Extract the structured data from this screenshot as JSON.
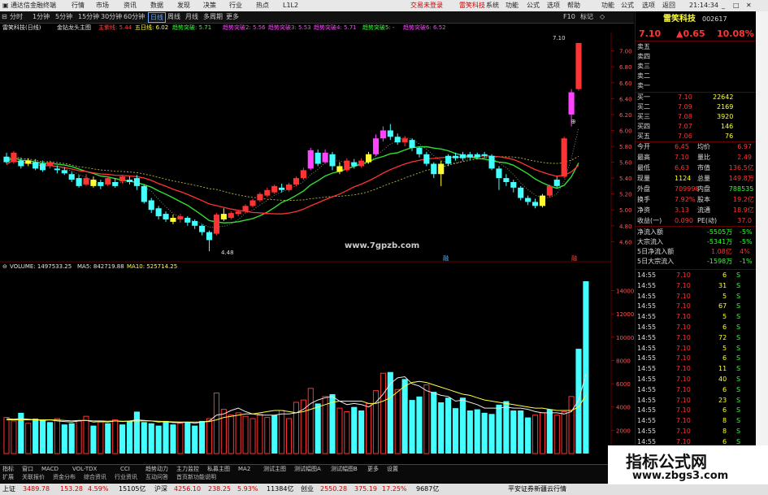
{
  "titlebar": {
    "app_name": "通达信金融终端",
    "menus": [
      "行情",
      "市场",
      "资讯",
      "数据",
      "发现",
      "决策",
      "行业",
      "热点",
      "L1L2"
    ],
    "center_links": [
      "交易未登录",
      "雷笑科技"
    ],
    "right_menus": [
      "系统",
      "功能",
      "公式",
      "选项",
      "帮助"
    ],
    "right_links": [
      "功能",
      "公式",
      "选项",
      "返回"
    ],
    "time": "21:14:34",
    "quote_label": "行情"
  },
  "periodbar": {
    "periods": [
      "分时",
      "1分钟",
      "5分钟",
      "15分钟",
      "30分钟",
      "60分钟",
      "日线",
      "周线",
      "月线",
      "多周期",
      "更多"
    ],
    "selected": "日线",
    "tools": [
      "F10",
      "标记",
      "◇"
    ]
  },
  "chart_info": {
    "stock_label": "雷笑科技(日线)",
    "indicator": "金钻龙头主图",
    "items": [
      {
        "text": "主紫线: 5.44",
        "color": "#ff4444"
      },
      {
        "text": "五日线: 6.02",
        "color": "#ffff44"
      },
      {
        "text": "趋势突破: 5.71",
        "color": "#33ff33"
      },
      {
        "text": "趋势突破2: 5.56",
        "color": "#ff44ff"
      },
      {
        "text": "趋势突破3: 5.53",
        "color": "#ff44ff"
      },
      {
        "text": "趋势突破4: 5.71",
        "color": "#ff44ff"
      },
      {
        "text": "趋势突破5: -",
        "color": "#33ff33"
      },
      {
        "text": "趋势突破6: 6.52",
        "color": "#ff44ff"
      }
    ],
    "high_label": "7.10",
    "low_label": "4.48",
    "watermark_site": "www.7gpzb.com",
    "axis_ticks": [
      "7.00",
      "6.80",
      "6.60",
      "6.40",
      "6.20",
      "6.00",
      "5.80",
      "5.60",
      "5.40",
      "5.20",
      "5.00",
      "4.80",
      "4.60"
    ],
    "markers": [
      "⊕",
      "融"
    ]
  },
  "chart_data": {
    "type": "candlestick",
    "title": "雷笑科技(日线)",
    "ylim": [
      4.45,
      7.15
    ],
    "candles": [
      {
        "o": 5.67,
        "c": 5.6,
        "h": 5.72,
        "l": 5.58,
        "col": "c"
      },
      {
        "o": 5.6,
        "c": 5.72,
        "h": 5.74,
        "l": 5.58,
        "col": "r"
      },
      {
        "o": 5.62,
        "c": 5.55,
        "h": 5.66,
        "l": 5.52,
        "col": "c"
      },
      {
        "o": 5.58,
        "c": 5.62,
        "h": 5.65,
        "l": 5.55,
        "col": "y"
      },
      {
        "o": 5.6,
        "c": 5.52,
        "h": 5.64,
        "l": 5.5,
        "col": "c"
      },
      {
        "o": 5.58,
        "c": 5.5,
        "h": 5.62,
        "l": 5.48,
        "col": "c"
      },
      {
        "o": 5.55,
        "c": 5.6,
        "h": 5.62,
        "l": 5.52,
        "col": "r"
      },
      {
        "o": 5.52,
        "c": 5.5,
        "h": 5.56,
        "l": 5.46,
        "col": "c"
      },
      {
        "o": 5.5,
        "c": 5.46,
        "h": 5.54,
        "l": 5.44,
        "col": "c"
      },
      {
        "o": 5.45,
        "c": 5.38,
        "h": 5.48,
        "l": 5.35,
        "col": "c"
      },
      {
        "o": 5.4,
        "c": 5.3,
        "h": 5.44,
        "l": 5.28,
        "col": "c"
      },
      {
        "o": 5.32,
        "c": 5.4,
        "h": 5.45,
        "l": 5.3,
        "col": "r"
      },
      {
        "o": 5.38,
        "c": 5.3,
        "h": 5.42,
        "l": 5.28,
        "col": "y"
      },
      {
        "o": 5.35,
        "c": 5.3,
        "h": 5.38,
        "l": 5.26,
        "col": "c"
      },
      {
        "o": 5.32,
        "c": 5.4,
        "h": 5.42,
        "l": 5.3,
        "col": "r"
      },
      {
        "o": 5.35,
        "c": 5.3,
        "h": 5.4,
        "l": 5.28,
        "col": "c"
      },
      {
        "o": 5.36,
        "c": 5.42,
        "h": 5.44,
        "l": 5.33,
        "col": "r"
      },
      {
        "o": 5.38,
        "c": 5.35,
        "h": 5.42,
        "l": 5.32,
        "col": "c"
      },
      {
        "o": 5.4,
        "c": 5.3,
        "h": 5.44,
        "l": 5.25,
        "col": "c"
      },
      {
        "o": 5.3,
        "c": 5.1,
        "h": 5.32,
        "l": 5.08,
        "col": "c"
      },
      {
        "o": 5.12,
        "c": 5.0,
        "h": 5.15,
        "l": 4.96,
        "col": "c"
      },
      {
        "o": 5.02,
        "c": 4.92,
        "h": 5.05,
        "l": 4.88,
        "col": "c"
      },
      {
        "o": 4.95,
        "c": 4.88,
        "h": 4.98,
        "l": 4.85,
        "col": "c"
      },
      {
        "o": 4.9,
        "c": 4.85,
        "h": 4.94,
        "l": 4.82,
        "col": "y"
      },
      {
        "o": 4.88,
        "c": 4.92,
        "h": 4.95,
        "l": 4.84,
        "col": "r"
      },
      {
        "o": 4.9,
        "c": 4.84,
        "h": 4.92,
        "l": 4.8,
        "col": "c"
      },
      {
        "o": 4.86,
        "c": 4.8,
        "h": 4.88,
        "l": 4.76,
        "col": "c"
      },
      {
        "o": 4.8,
        "c": 4.72,
        "h": 4.82,
        "l": 4.68,
        "col": "c"
      },
      {
        "o": 4.72,
        "c": 4.62,
        "h": 4.74,
        "l": 4.48,
        "col": "c"
      },
      {
        "o": 4.7,
        "c": 4.94,
        "h": 4.96,
        "l": 4.68,
        "col": "r"
      },
      {
        "o": 4.95,
        "c": 4.88,
        "h": 5.02,
        "l": 4.86,
        "col": "y"
      },
      {
        "o": 4.9,
        "c": 4.96,
        "h": 4.98,
        "l": 4.88,
        "col": "r"
      },
      {
        "o": 4.95,
        "c": 4.98,
        "h": 5.0,
        "l": 4.92,
        "col": "r"
      },
      {
        "o": 4.98,
        "c": 5.05,
        "h": 5.07,
        "l": 4.96,
        "col": "r"
      },
      {
        "o": 5.05,
        "c": 5.12,
        "h": 5.14,
        "l": 5.03,
        "col": "r"
      },
      {
        "o": 5.12,
        "c": 5.2,
        "h": 5.22,
        "l": 5.1,
        "col": "r"
      },
      {
        "o": 5.18,
        "c": 5.25,
        "h": 5.28,
        "l": 5.16,
        "col": "r"
      },
      {
        "o": 5.22,
        "c": 5.3,
        "h": 5.32,
        "l": 5.2,
        "col": "r"
      },
      {
        "o": 5.28,
        "c": 5.25,
        "h": 5.33,
        "l": 5.22,
        "col": "c"
      },
      {
        "o": 5.25,
        "c": 5.32,
        "h": 5.34,
        "l": 5.23,
        "col": "r"
      },
      {
        "o": 5.32,
        "c": 5.4,
        "h": 5.42,
        "l": 5.3,
        "col": "r"
      },
      {
        "o": 5.4,
        "c": 5.5,
        "h": 5.53,
        "l": 5.38,
        "col": "r"
      },
      {
        "o": 5.52,
        "c": 5.75,
        "h": 5.78,
        "l": 5.5,
        "col": "m"
      },
      {
        "o": 5.72,
        "c": 5.58,
        "h": 5.76,
        "l": 5.55,
        "col": "c"
      },
      {
        "o": 5.6,
        "c": 5.72,
        "h": 5.76,
        "l": 5.58,
        "col": "m"
      },
      {
        "o": 5.7,
        "c": 5.55,
        "h": 5.73,
        "l": 5.5,
        "col": "c"
      },
      {
        "o": 5.55,
        "c": 5.48,
        "h": 5.6,
        "l": 5.45,
        "col": "y"
      },
      {
        "o": 5.5,
        "c": 5.62,
        "h": 5.65,
        "l": 5.48,
        "col": "r"
      },
      {
        "o": 5.6,
        "c": 5.55,
        "h": 5.64,
        "l": 5.52,
        "col": "c"
      },
      {
        "o": 5.55,
        "c": 5.62,
        "h": 5.65,
        "l": 5.53,
        "col": "r"
      },
      {
        "o": 5.6,
        "c": 5.7,
        "h": 5.73,
        "l": 5.58,
        "col": "y"
      },
      {
        "o": 5.7,
        "c": 5.9,
        "h": 5.95,
        "l": 5.68,
        "col": "m"
      },
      {
        "o": 5.9,
        "c": 6.0,
        "h": 6.05,
        "l": 5.86,
        "col": "m"
      },
      {
        "o": 6.0,
        "c": 5.92,
        "h": 6.08,
        "l": 5.88,
        "col": "c"
      },
      {
        "o": 5.92,
        "c": 5.85,
        "h": 5.96,
        "l": 5.82,
        "col": "c"
      },
      {
        "o": 5.85,
        "c": 5.9,
        "h": 5.93,
        "l": 5.8,
        "col": "r"
      },
      {
        "o": 5.88,
        "c": 5.78,
        "h": 5.9,
        "l": 5.74,
        "col": "c"
      },
      {
        "o": 5.78,
        "c": 5.7,
        "h": 5.8,
        "l": 5.66,
        "col": "c"
      },
      {
        "o": 5.7,
        "c": 5.58,
        "h": 5.73,
        "l": 5.55,
        "col": "c"
      },
      {
        "o": 5.58,
        "c": 5.45,
        "h": 5.6,
        "l": 5.4,
        "col": "c"
      },
      {
        "o": 5.45,
        "c": 5.58,
        "h": 5.62,
        "l": 5.3,
        "col": "y"
      },
      {
        "o": 5.58,
        "c": 5.68,
        "h": 5.7,
        "l": 5.55,
        "col": "c"
      },
      {
        "o": 5.68,
        "c": 5.65,
        "h": 5.72,
        "l": 5.62,
        "col": "c"
      },
      {
        "o": 5.65,
        "c": 5.7,
        "h": 5.73,
        "l": 5.62,
        "col": "c"
      },
      {
        "o": 5.7,
        "c": 5.66,
        "h": 5.73,
        "l": 5.63,
        "col": "c"
      },
      {
        "o": 5.66,
        "c": 5.7,
        "h": 5.72,
        "l": 5.64,
        "col": "c"
      },
      {
        "o": 5.7,
        "c": 5.68,
        "h": 5.73,
        "l": 5.65,
        "col": "c"
      },
      {
        "o": 5.68,
        "c": 5.52,
        "h": 5.7,
        "l": 5.5,
        "col": "c"
      },
      {
        "o": 5.52,
        "c": 5.4,
        "h": 5.55,
        "l": 5.25,
        "col": "c"
      },
      {
        "o": 5.4,
        "c": 5.35,
        "h": 5.45,
        "l": 5.3,
        "col": "c"
      },
      {
        "o": 5.35,
        "c": 5.28,
        "h": 5.38,
        "l": 5.22,
        "col": "c"
      },
      {
        "o": 5.28,
        "c": 5.15,
        "h": 5.3,
        "l": 5.12,
        "col": "c"
      },
      {
        "o": 5.15,
        "c": 5.1,
        "h": 5.18,
        "l": 5.06,
        "col": "c"
      },
      {
        "o": 5.1,
        "c": 5.05,
        "h": 5.14,
        "l": 5.02,
        "col": "c"
      },
      {
        "o": 5.05,
        "c": 5.18,
        "h": 5.2,
        "l": 5.03,
        "col": "y"
      },
      {
        "o": 5.18,
        "c": 5.3,
        "h": 5.32,
        "l": 5.16,
        "col": "r"
      },
      {
        "o": 5.3,
        "c": 5.38,
        "h": 5.42,
        "l": 5.28,
        "col": "c"
      },
      {
        "o": 5.42,
        "c": 5.9,
        "h": 5.92,
        "l": 5.4,
        "col": "r"
      },
      {
        "o": 6.2,
        "c": 6.48,
        "h": 6.52,
        "l": 6.05,
        "col": "m"
      },
      {
        "o": 6.52,
        "c": 7.1,
        "h": 7.1,
        "l": 6.5,
        "col": "r"
      }
    ],
    "volumes": [
      3100,
      2800,
      3500,
      2600,
      3000,
      2900,
      2700,
      3000,
      2500,
      2600,
      2800,
      3200,
      2400,
      2700,
      2600,
      2900,
      2500,
      2800,
      3600,
      2700,
      2600,
      2400,
      2800,
      2500,
      2600,
      2700,
      2400,
      2800,
      3000,
      5200,
      3800,
      3300,
      3500,
      3200,
      3000,
      3400,
      3100,
      3300,
      3700,
      3000,
      4400,
      4600,
      5600,
      4300,
      4900,
      5100,
      3900,
      3600,
      4000,
      3700,
      4300,
      5400,
      6900,
      7000,
      5500,
      6400,
      4600,
      4900,
      5900,
      5300,
      4400,
      4800,
      3900,
      4800,
      3700,
      3800,
      3500,
      3400,
      4200,
      4500,
      3700,
      3700,
      3100,
      3300,
      3500,
      3800,
      3300,
      3600,
      4900,
      9000,
      14800
    ],
    "vol_colors": "rrcrcccrccrrcrcrccccccccrcccrrrrrrrrrcrrrrrcrcrrccrrrcrcccrccccccccccccccrrcrrr",
    "ma5_values": [
      3000,
      2950,
      3000,
      2950,
      2900,
      2850,
      2900,
      2800,
      2750,
      2700,
      2800,
      2850,
      2700,
      2750,
      2700,
      2800,
      2750,
      2800,
      2900,
      2850,
      2800,
      2700,
      2750,
      2650,
      2650,
      2700,
      2600,
      2700,
      2800,
      3300,
      3400,
      3700,
      3900,
      3600,
      3400,
      3300,
      3300,
      3300,
      3400,
      3400,
      3500,
      3800,
      4300,
      4600,
      4800,
      4900,
      4500,
      4200,
      4300,
      4200,
      4000,
      4400,
      5100,
      6000,
      6500,
      6600,
      6000,
      5800,
      5400,
      5200,
      5000,
      4900,
      4500,
      4600,
      4400,
      4200,
      3900,
      3900,
      3900,
      4000,
      3900,
      3900,
      3800,
      3600,
      3500,
      3500,
      3500,
      3400,
      3600,
      4600,
      6800
    ],
    "ma10_values": [
      2900,
      2900,
      2900,
      2900,
      2900,
      2900,
      2900,
      2880,
      2850,
      2800,
      2850,
      2850,
      2800,
      2800,
      2780,
      2800,
      2780,
      2780,
      2800,
      2800,
      2800,
      2780,
      2750,
      2720,
      2700,
      2700,
      2700,
      2700,
      2750,
      2900,
      3100,
      3200,
      3300,
      3400,
      3400,
      3500,
      3600,
      3700,
      3700,
      3600,
      3500,
      3600,
      3800,
      4000,
      4200,
      4400,
      4500,
      4500,
      4500,
      4500,
      4300,
      4300,
      4500,
      4800,
      5300,
      5800,
      6100,
      6200,
      6100,
      5900,
      5700,
      5500,
      5300,
      5100,
      5000,
      4800,
      4600,
      4500,
      4400,
      4300,
      4200,
      4100,
      4000,
      3900,
      3900,
      3800,
      3700,
      3700,
      3700,
      4000,
      5000
    ],
    "vol_ylim": [
      0,
      15500
    ],
    "vol_ticks": [
      14000,
      12000,
      10000,
      8000,
      6000,
      4000,
      2000
    ]
  },
  "volinfo": {
    "label": "VOLUME: 1497533.25",
    "ma5": "MA5: 842719.88",
    "ma10": "MA10: 525714.25"
  },
  "tabs": [
    "指标",
    "窗口",
    "MACD",
    "VOL-TDX",
    "CCI",
    "趋势动力",
    "主力监控",
    "私募主图",
    "MA2",
    "测试主图",
    "测试幅图A",
    "测试幅图B",
    "更多",
    "设置"
  ],
  "tabs2": [
    "扩展",
    "关联报价",
    "资金分布",
    "综合资讯",
    "行业资讯",
    "互动问答",
    "首页新功能说明"
  ],
  "right": {
    "name": "雷笑科技",
    "code": "002617",
    "price": "7.10",
    "change": "▲0.65",
    "pct": "10.08%",
    "asks": [
      "卖五",
      "卖四",
      "卖三",
      "卖二",
      "卖一"
    ],
    "bids": [
      {
        "label": "买一",
        "price": "7.10",
        "vol": "22642"
      },
      {
        "label": "买二",
        "price": "7.09",
        "vol": "2169"
      },
      {
        "label": "买三",
        "price": "7.08",
        "vol": "3920"
      },
      {
        "label": "买四",
        "price": "7.07",
        "vol": "146"
      },
      {
        "label": "买五",
        "price": "7.06",
        "vol": "76"
      }
    ],
    "stats": [
      {
        "l": "今开",
        "v": "6.45",
        "l2": "均价",
        "v2": "6.97"
      },
      {
        "l": "最高",
        "v": "7.10",
        "l2": "量比",
        "v2": "2.49"
      },
      {
        "l": "最低",
        "v": "6.63",
        "l2": "市值",
        "v2": "136.5亿"
      },
      {
        "l": "现量",
        "v": "1124",
        "l2": "总量",
        "v2": "149.8万"
      },
      {
        "l": "外盘",
        "v": "709998",
        "l2": "内盘",
        "v2": "788535"
      },
      {
        "l": "换手",
        "v": "7.92%",
        "l2": "股本",
        "v2": "19.2亿"
      },
      {
        "l": "净资",
        "v": "3.13",
        "l2": "流通",
        "v2": "18.9亿"
      },
      {
        "l": "收益(一)",
        "v": "0.090",
        "l2": "PE(动)",
        "v2": "37.0"
      }
    ],
    "flows": [
      {
        "l": "净流入额",
        "v": "-5505万",
        "p": "-5%",
        "c": "green"
      },
      {
        "l": "大宗流入",
        "v": "-5341万",
        "p": "-5%",
        "c": "green"
      },
      {
        "l": "5日净流入额",
        "v": "1.08亿",
        "p": "4%",
        "c": "red"
      },
      {
        "l": "5日大宗流入",
        "v": "-1598万",
        "p": "-1%",
        "c": "green"
      }
    ],
    "ticks": [
      {
        "t": "14:55",
        "p": "7.10",
        "v": "6",
        "s": "S"
      },
      {
        "t": "14:55",
        "p": "7.10",
        "v": "31",
        "s": "S"
      },
      {
        "t": "14:55",
        "p": "7.10",
        "v": "5",
        "s": "S"
      },
      {
        "t": "14:55",
        "p": "7.10",
        "v": "67",
        "s": "S"
      },
      {
        "t": "14:55",
        "p": "7.10",
        "v": "5",
        "s": "S"
      },
      {
        "t": "14:55",
        "p": "7.10",
        "v": "6",
        "s": "S"
      },
      {
        "t": "14:55",
        "p": "7.10",
        "v": "72",
        "s": "S"
      },
      {
        "t": "14:55",
        "p": "7.10",
        "v": "5",
        "s": "S"
      },
      {
        "t": "14:55",
        "p": "7.10",
        "v": "6",
        "s": "S"
      },
      {
        "t": "14:55",
        "p": "7.10",
        "v": "11",
        "s": "S"
      },
      {
        "t": "14:55",
        "p": "7.10",
        "v": "40",
        "s": "S"
      },
      {
        "t": "14:55",
        "p": "7.10",
        "v": "6",
        "s": "S"
      },
      {
        "t": "14:55",
        "p": "7.10",
        "v": "23",
        "s": "S"
      },
      {
        "t": "14:55",
        "p": "7.10",
        "v": "6",
        "s": "S"
      },
      {
        "t": "14:55",
        "p": "7.10",
        "v": "8",
        "s": "S"
      },
      {
        "t": "14:55",
        "p": "7.10",
        "v": "8",
        "s": "S"
      },
      {
        "t": "14:55",
        "p": "7.10",
        "v": "6",
        "s": "S"
      }
    ]
  },
  "statusbar": {
    "sh_label": "上证",
    "sh_val": "3489.78",
    "sh_chg": "153.28",
    "sh_pct": "4.59%",
    "sh_amt": "15105亿",
    "sz_label": "沪深",
    "sz_val": "4256.10",
    "sz_chg": "238.25",
    "sz_pct": "5.93%",
    "sz_amt": "11384亿",
    "cy_label": "创业",
    "cy_val": "2550.28",
    "cy_chg": "375.19",
    "cy_pct": "17.25%",
    "cy_amt": "9687亿",
    "broker": "平安证券新疆云行情"
  },
  "watermark": {
    "brand": "指标公式网",
    "site": "www.zbgs3.com"
  },
  "colors": {
    "up": "#ff3333",
    "down": "#44ffff",
    "yellow": "#ffff33",
    "magenta": "#ff44ff",
    "ma_green": "#33dd33",
    "ma_red": "#ff3333",
    "bg": "#000000"
  }
}
